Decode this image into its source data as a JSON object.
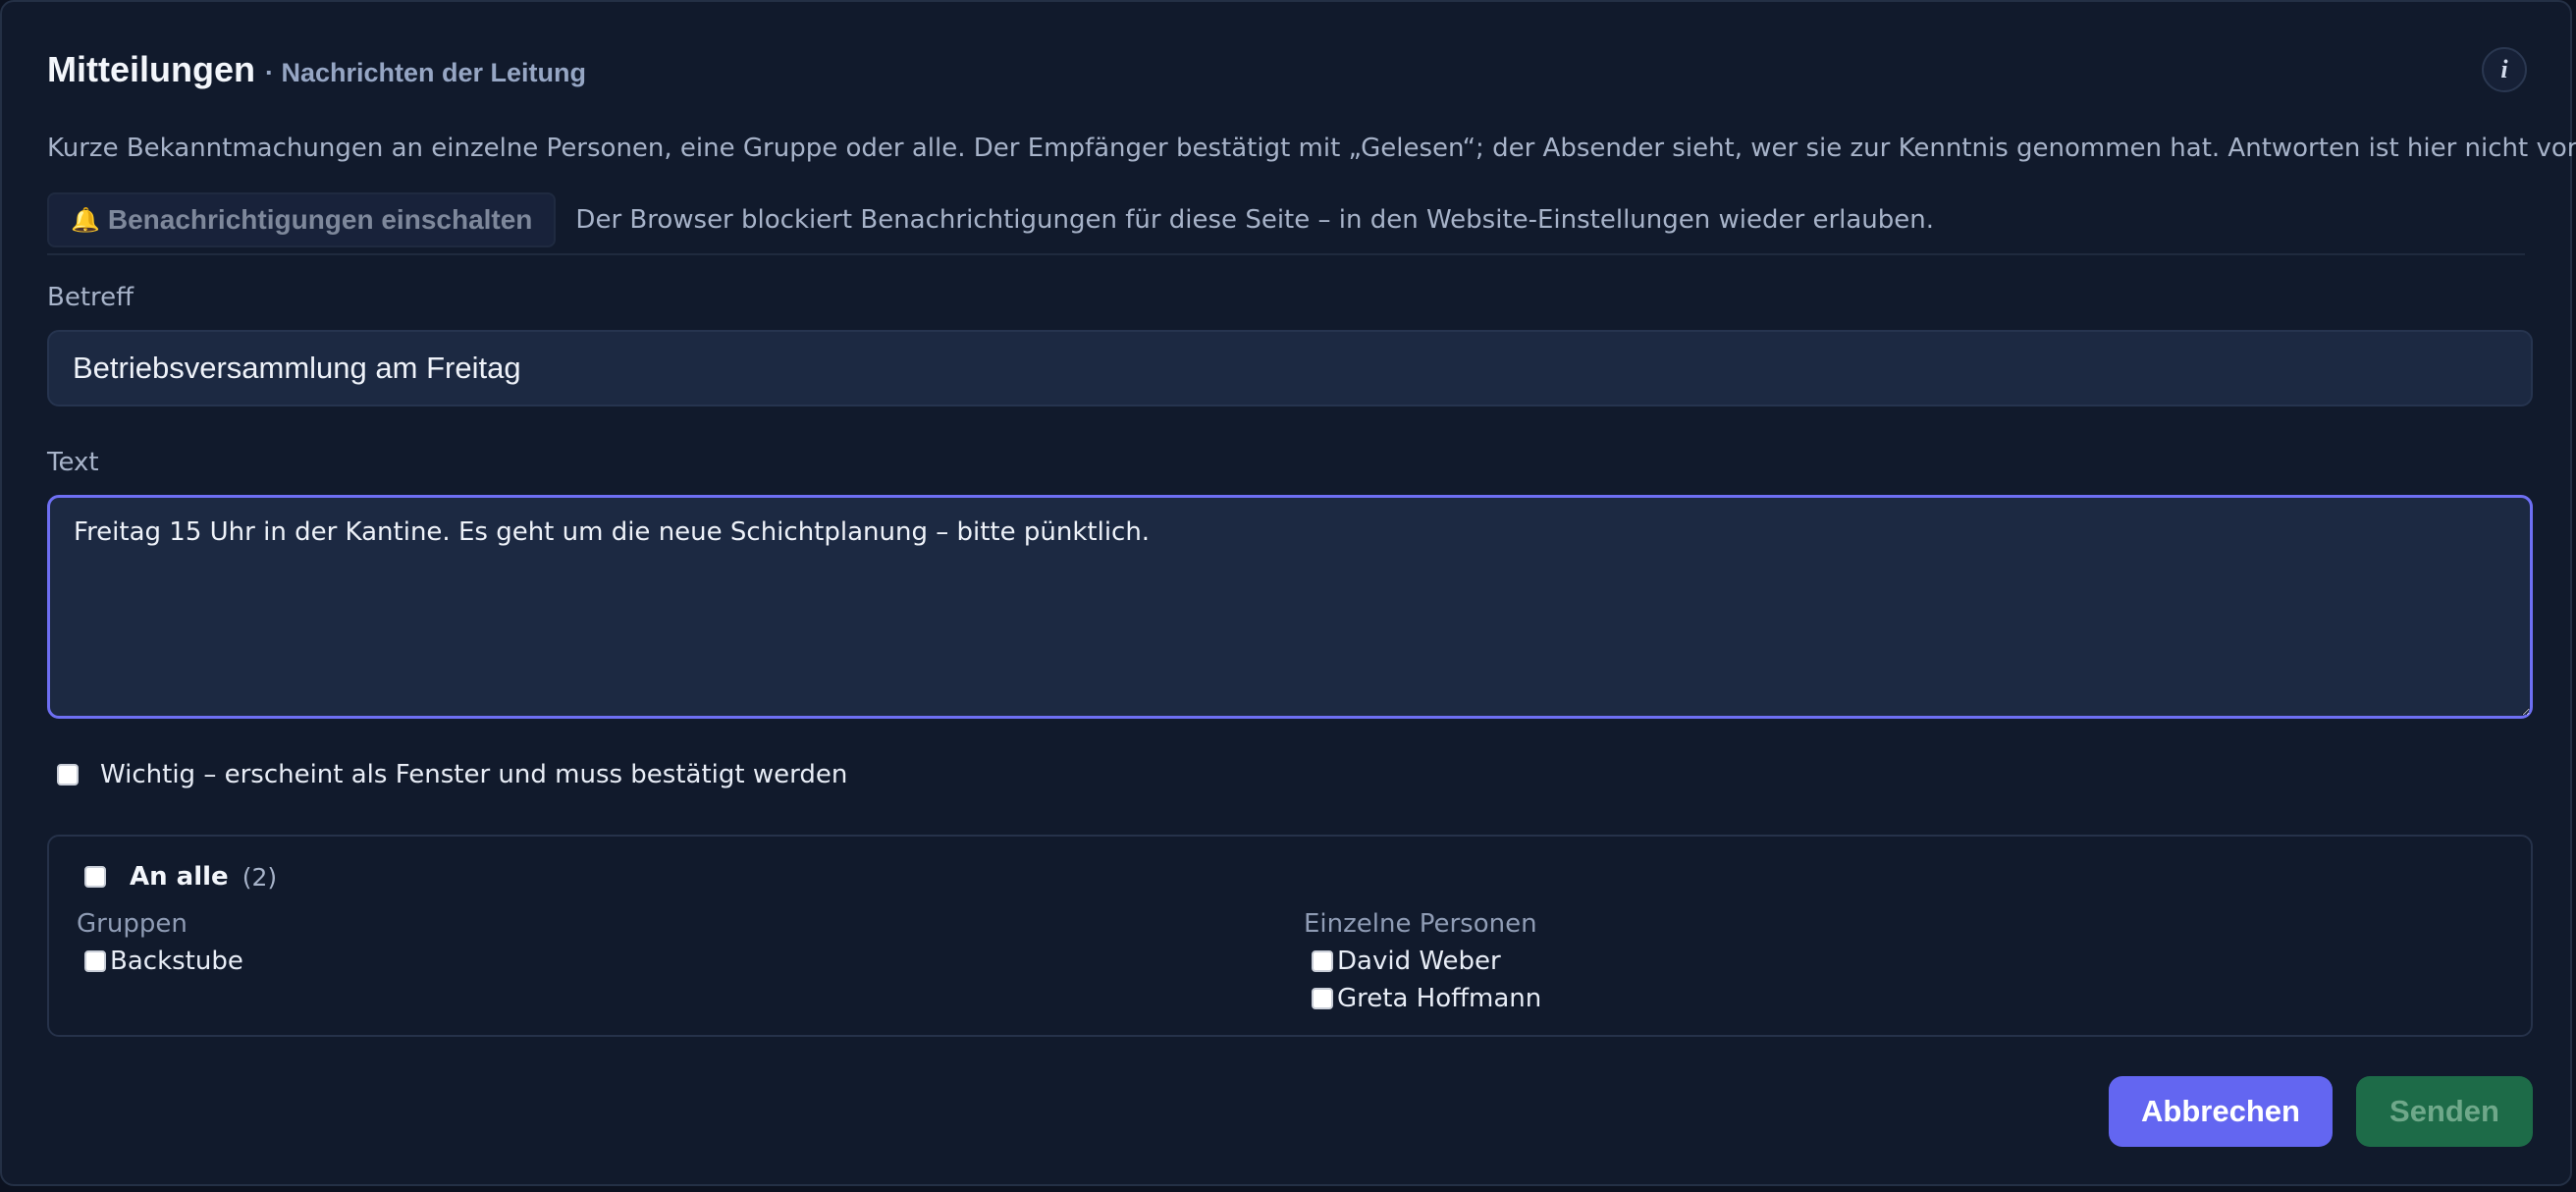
{
  "dialog": {
    "title": "Mitteilungen",
    "subtitle": "· Nachrichten der Leitung",
    "info_icon": "i",
    "intro": "Kurze Bekanntmachungen an einzelne Personen, eine Gruppe oder alle. Der Empfänger bestätigt mit „Gelesen“; der Absender sieht, wer sie zur Kenntnis genommen hat. Antworten ist hier nicht vorgesehen."
  },
  "notifications": {
    "icon": "bell-icon",
    "icon_glyph": "🔔",
    "button_label": "Benachrichtigungen einschalten",
    "note": "Der Browser blockiert Benachrichtigungen für diese Seite – in den Website-Einstellungen wieder erlauben."
  },
  "form": {
    "subject_label": "Betreff",
    "subject_value": "Betriebsversammlung am Freitag",
    "text_label": "Text",
    "text_value": "Freitag 15 Uhr in der Kantine. Es geht um die neue Schichtplanung – bitte pünktlich.",
    "important_label": "Wichtig – erscheint als Fenster und muss bestätigt werden",
    "important_checked": false
  },
  "recipients": {
    "all_label": "An alle",
    "all_count": "(2)",
    "groups_title": "Gruppen",
    "groups": [
      {
        "label": "Backstube",
        "checked": false
      }
    ],
    "persons_title": "Einzelne Personen",
    "persons": [
      {
        "label": "David Weber",
        "checked": false
      },
      {
        "label": "Greta Hoffmann",
        "checked": false
      }
    ]
  },
  "actions": {
    "cancel_label": "Abbrechen",
    "send_label": "Senden"
  },
  "colors": {
    "background": "#111a2c",
    "accent": "#6366f1",
    "send": "#1d6b48"
  }
}
